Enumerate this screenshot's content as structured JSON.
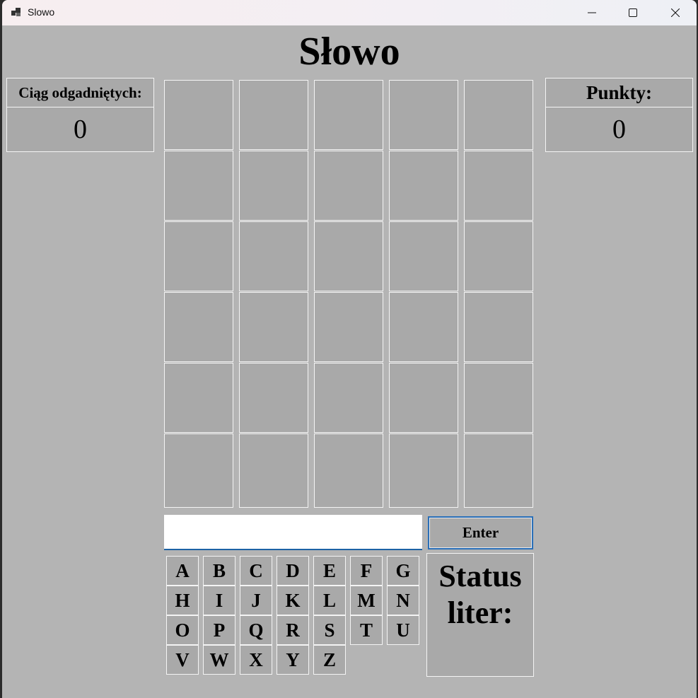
{
  "window": {
    "title": "Slowo",
    "icon": "app-window-icon",
    "controls": [
      "minimize-icon",
      "maximize-icon",
      "close-icon"
    ]
  },
  "page": {
    "title": "Słowo"
  },
  "streak": {
    "label": "Ciąg odgadniętych:",
    "value": "0"
  },
  "points": {
    "label": "Punkty:",
    "value": "0"
  },
  "grid": {
    "rows": 6,
    "cols": 5,
    "cells": [
      [
        "",
        "",
        "",
        "",
        ""
      ],
      [
        "",
        "",
        "",
        "",
        ""
      ],
      [
        "",
        "",
        "",
        "",
        ""
      ],
      [
        "",
        "",
        "",
        "",
        ""
      ],
      [
        "",
        "",
        "",
        "",
        ""
      ],
      [
        "",
        "",
        "",
        "",
        ""
      ]
    ]
  },
  "input": {
    "value": "",
    "placeholder": ""
  },
  "enter_button": {
    "label": "Enter"
  },
  "keyboard": {
    "rows": [
      [
        "A",
        "B",
        "C",
        "D",
        "E",
        "F",
        "G"
      ],
      [
        "H",
        "I",
        "J",
        "K",
        "L",
        "M",
        "N"
      ],
      [
        "O",
        "P",
        "Q",
        "R",
        "S",
        "T",
        "U"
      ],
      [
        "V",
        "W",
        "X",
        "Y",
        "Z"
      ]
    ]
  },
  "status": {
    "line1": "Status",
    "line2": "liter:"
  },
  "colors": {
    "background": "#b4b4b4",
    "tile": "#a9a9a9",
    "border": "#f4f4f4",
    "accent": "#1d62a5"
  }
}
